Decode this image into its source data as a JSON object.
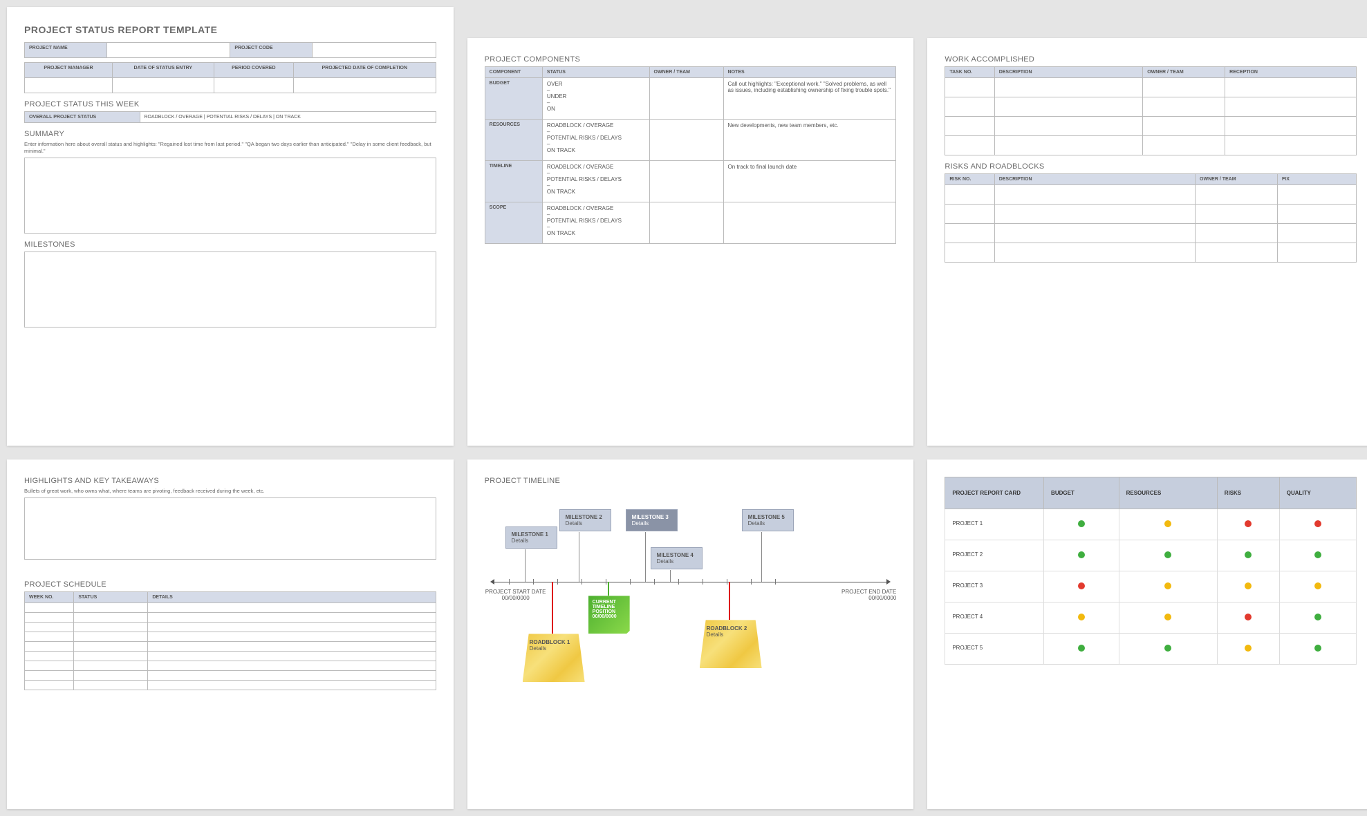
{
  "p1": {
    "title": "PROJECT STATUS REPORT TEMPLATE",
    "info": {
      "name": "PROJECT NAME",
      "code": "PROJECT CODE",
      "manager": "PROJECT MANAGER",
      "entry": "DATE OF STATUS ENTRY",
      "period": "PERIOD COVERED",
      "projected": "PROJECTED DATE OF COMPLETION"
    },
    "week_title": "PROJECT STATUS THIS WEEK",
    "overall_label": "OVERALL PROJECT STATUS",
    "overall_opts": "ROADBLOCK / OVERAGE   |   POTENTIAL RISKS / DELAYS   |   ON TRACK",
    "summary_title": "SUMMARY",
    "summary_hint": "Enter information here about overall status and highlights: \"Regained lost time from last period.\" \"QA began two days earlier than anticipated.\" \"Delay in some client feedback, but minimal.\"",
    "milestones_title": "MILESTONES"
  },
  "p2": {
    "title": "PROJECT COMPONENTS",
    "headers": [
      "COMPONENT",
      "STATUS",
      "OWNER / TEAM",
      "NOTES"
    ],
    "rows": [
      {
        "comp": "BUDGET",
        "status": "OVER\n–\nUNDER\n–\nON",
        "notes": "Call out highlights: \"Exceptional work.\" \"Solved problems, as well as issues, including establishing ownership of fixing trouble spots.\""
      },
      {
        "comp": "RESOURCES",
        "status": "ROADBLOCK / OVERAGE\n–\nPOTENTIAL RISKS / DELAYS\n–\nON TRACK",
        "notes": "New developments, new team members, etc."
      },
      {
        "comp": "TIMELINE",
        "status": "ROADBLOCK / OVERAGE\n–\nPOTENTIAL RISKS / DELAYS\n–\nON TRACK",
        "notes": "On track to final launch date"
      },
      {
        "comp": "SCOPE",
        "status": "ROADBLOCK / OVERAGE\n–\nPOTENTIAL RISKS / DELAYS\n–\nON TRACK",
        "notes": ""
      }
    ]
  },
  "p3": {
    "work_title": "WORK ACCOMPLISHED",
    "work_headers": [
      "TASK NO.",
      "DESCRIPTION",
      "OWNER / TEAM",
      "RECEPTION"
    ],
    "risk_title": "RISKS AND ROADBLOCKS",
    "risk_headers": [
      "RISK NO.",
      "DESCRIPTION",
      "OWNER / TEAM",
      "FIX"
    ]
  },
  "p4": {
    "hl_title": "HIGHLIGHTS AND KEY TAKEAWAYS",
    "hl_hint": "Bullets of great work, who owns what, where teams are pivoting, feedback received during the week, etc.",
    "sched_title": "PROJECT SCHEDULE",
    "sched_headers": [
      "WEEK NO.",
      "STATUS",
      "DETAILS"
    ]
  },
  "p5": {
    "title": "PROJECT TIMELINE",
    "start_lbl": "PROJECT START DATE",
    "start_date": "00/00/0000",
    "end_lbl": "PROJECT END DATE",
    "end_date": "00/00/0000",
    "m": [
      "MILESTONE 1",
      "MILESTONE 2",
      "MILESTONE 3",
      "MILESTONE 4",
      "MILESTONE 5"
    ],
    "det": "Details",
    "r1": "ROADBLOCK 1",
    "r2": "ROADBLOCK 2",
    "cur1": "CURRENT",
    "cur2": "TIMELINE",
    "cur3": "POSITION",
    "cur4": "00/00/0000"
  },
  "p6": {
    "headers": [
      "PROJECT REPORT CARD",
      "BUDGET",
      "RESOURCES",
      "RISKS",
      "QUALITY"
    ],
    "rows": [
      {
        "name": "PROJECT 1",
        "cells": [
          "g",
          "y",
          "r",
          "r"
        ]
      },
      {
        "name": "PROJECT 2",
        "cells": [
          "g",
          "g",
          "g",
          "g"
        ]
      },
      {
        "name": "PROJECT 3",
        "cells": [
          "r",
          "y",
          "y",
          "y"
        ]
      },
      {
        "name": "PROJECT 4",
        "cells": [
          "y",
          "y",
          "r",
          "g"
        ]
      },
      {
        "name": "PROJECT 5",
        "cells": [
          "g",
          "g",
          "y",
          "g"
        ]
      }
    ]
  }
}
